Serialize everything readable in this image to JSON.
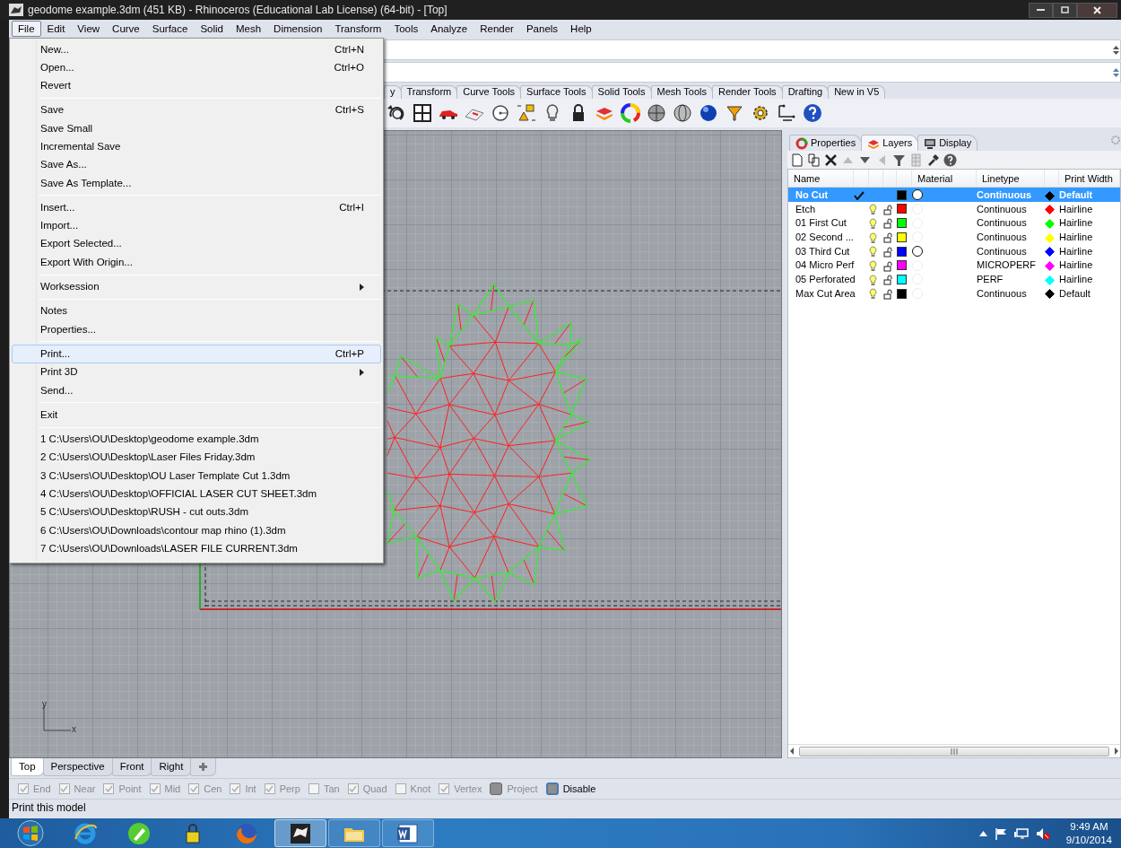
{
  "window": {
    "title": "geodome example.3dm (451 KB) - Rhinoceros (Educational Lab License) (64-bit) - [Top]"
  },
  "menu_bar": [
    {
      "label": "File",
      "selected": true
    },
    {
      "label": "Edit",
      "selected": false
    },
    {
      "label": "View",
      "selected": false
    },
    {
      "label": "Curve",
      "selected": false
    },
    {
      "label": "Surface",
      "selected": false
    },
    {
      "label": "Solid",
      "selected": false
    },
    {
      "label": "Mesh",
      "selected": false
    },
    {
      "label": "Dimension",
      "selected": false
    },
    {
      "label": "Transform",
      "selected": false
    },
    {
      "label": "Tools",
      "selected": false
    },
    {
      "label": "Analyze",
      "selected": false
    },
    {
      "label": "Render",
      "selected": false
    },
    {
      "label": "Panels",
      "selected": false
    },
    {
      "label": "Help",
      "selected": false
    }
  ],
  "file_menu": {
    "groups": [
      [
        {
          "label": "New...",
          "shortcut": "Ctrl+N",
          "submenu": false,
          "highlighted": false
        },
        {
          "label": "Open...",
          "shortcut": "Ctrl+O",
          "submenu": false,
          "highlighted": false
        },
        {
          "label": "Revert",
          "submenu": false,
          "highlighted": false
        }
      ],
      [
        {
          "label": "Save",
          "shortcut": "Ctrl+S",
          "submenu": false,
          "highlighted": false
        },
        {
          "label": "Save Small",
          "submenu": false,
          "highlighted": false
        },
        {
          "label": "Incremental Save",
          "submenu": false,
          "highlighted": false
        },
        {
          "label": "Save As...",
          "submenu": false,
          "highlighted": false
        },
        {
          "label": "Save As Template...",
          "submenu": false,
          "highlighted": false
        }
      ],
      [
        {
          "label": "Insert...",
          "shortcut": "Ctrl+I",
          "submenu": false,
          "highlighted": false
        },
        {
          "label": "Import...",
          "submenu": false,
          "highlighted": false
        },
        {
          "label": "Export Selected...",
          "submenu": false,
          "highlighted": false
        },
        {
          "label": "Export With Origin...",
          "submenu": false,
          "highlighted": false
        }
      ],
      [
        {
          "label": "Worksession",
          "submenu": true,
          "highlighted": false
        }
      ],
      [
        {
          "label": "Notes",
          "submenu": false,
          "highlighted": false
        },
        {
          "label": "Properties...",
          "submenu": false,
          "highlighted": false
        }
      ],
      [
        {
          "label": "Print...",
          "shortcut": "Ctrl+P",
          "submenu": false,
          "highlighted": true
        },
        {
          "label": "Print 3D",
          "submenu": true,
          "highlighted": false
        },
        {
          "label": "Send...",
          "submenu": false,
          "highlighted": false
        }
      ],
      [
        {
          "label": "Exit",
          "submenu": false,
          "highlighted": false
        }
      ],
      [
        {
          "label": "1 C:\\Users\\OU\\Desktop\\geodome example.3dm",
          "submenu": false,
          "highlighted": false
        },
        {
          "label": "2 C:\\Users\\OU\\Desktop\\Laser Files Friday.3dm",
          "submenu": false,
          "highlighted": false
        },
        {
          "label": "3 C:\\Users\\OU\\Desktop\\OU Laser Template Cut 1.3dm",
          "submenu": false,
          "highlighted": false
        },
        {
          "label": "4 C:\\Users\\OU\\Desktop\\OFFICIAL LASER CUT SHEET.3dm",
          "submenu": false,
          "highlighted": false
        },
        {
          "label": "5 C:\\Users\\OU\\Desktop\\RUSH - cut outs.3dm",
          "submenu": false,
          "highlighted": false
        },
        {
          "label": "6 C:\\Users\\OU\\Downloads\\contour map rhino  (1).3dm",
          "submenu": false,
          "highlighted": false
        },
        {
          "label": "7 C:\\Users\\OU\\Downloads\\LASER FILE CURRENT.3dm",
          "submenu": false,
          "highlighted": false
        }
      ]
    ]
  },
  "toolbar_tabs": [
    "y",
    "Transform",
    "Curve Tools",
    "Surface Tools",
    "Solid Tools",
    "Mesh Tools",
    "Render Tools",
    "Drafting",
    "New in V5"
  ],
  "panel": {
    "tabs": [
      {
        "label": "Properties",
        "selected": false
      },
      {
        "label": "Layers",
        "selected": true
      },
      {
        "label": "Display",
        "selected": false
      }
    ],
    "columns": [
      "Name",
      "Material",
      "Linetype",
      "Print Width"
    ],
    "rows": [
      {
        "name": "No Cut",
        "selected": true,
        "current": true,
        "color": "#000000",
        "material_set": true,
        "linetype": "Continuous",
        "print": {
          "color": "#000000",
          "width": "Default"
        }
      },
      {
        "name": "Etch",
        "selected": false,
        "current": false,
        "color": "#ff0000",
        "material_set": false,
        "linetype": "Continuous",
        "print": {
          "color": "#ff0000",
          "width": "Hairline"
        }
      },
      {
        "name": "01 First Cut",
        "selected": false,
        "current": false,
        "color": "#00ff00",
        "material_set": false,
        "linetype": "Continuous",
        "print": {
          "color": "#00ff00",
          "width": "Hairline"
        }
      },
      {
        "name": "02 Second ...",
        "selected": false,
        "current": false,
        "color": "#ffff00",
        "material_set": false,
        "linetype": "Continuous",
        "print": {
          "color": "#ffff00",
          "width": "Hairline"
        }
      },
      {
        "name": "03 Third Cut",
        "selected": false,
        "current": false,
        "color": "#0000ff",
        "material_set": true,
        "linetype": "Continuous",
        "print": {
          "color": "#0000ff",
          "width": "Hairline"
        }
      },
      {
        "name": "04 Micro Perf",
        "selected": false,
        "current": false,
        "color": "#ff00ff",
        "material_set": false,
        "linetype": "MICROPERF",
        "print": {
          "color": "#ff00ff",
          "width": "Hairline"
        }
      },
      {
        "name": "05 Perforated",
        "selected": false,
        "current": false,
        "color": "#00ffff",
        "material_set": false,
        "linetype": "PERF",
        "print": {
          "color": "#00ffff",
          "width": "Hairline"
        }
      },
      {
        "name": "Max Cut Area",
        "selected": false,
        "current": false,
        "color": "#000000",
        "material_set": false,
        "linetype": "Continuous",
        "print": {
          "color": "#000000",
          "width": "Default"
        }
      }
    ]
  },
  "viewport": {
    "axis_labels": [
      "y",
      "x"
    ],
    "tabs": [
      {
        "label": "Top",
        "selected": true
      },
      {
        "label": "Perspective",
        "selected": false
      },
      {
        "label": "Front",
        "selected": false
      },
      {
        "label": "Right",
        "selected": false
      }
    ]
  },
  "osnaps": [
    {
      "kind": "check",
      "label": "End",
      "checked": true,
      "disabled": true
    },
    {
      "kind": "check",
      "label": "Near",
      "checked": true,
      "disabled": true
    },
    {
      "kind": "check",
      "label": "Point",
      "checked": true,
      "disabled": true
    },
    {
      "kind": "check",
      "label": "Mid",
      "checked": true,
      "disabled": true
    },
    {
      "kind": "check",
      "label": "Cen",
      "checked": true,
      "disabled": true
    },
    {
      "kind": "check",
      "label": "Int",
      "checked": true,
      "disabled": true
    },
    {
      "kind": "check",
      "label": "Perp",
      "checked": true,
      "disabled": true
    },
    {
      "kind": "check",
      "label": "Tan",
      "checked": false,
      "disabled": true
    },
    {
      "kind": "check",
      "label": "Quad",
      "checked": true,
      "disabled": true
    },
    {
      "kind": "check",
      "label": "Knot",
      "checked": false,
      "disabled": true
    },
    {
      "kind": "check",
      "label": "Vertex",
      "checked": true,
      "disabled": true
    },
    {
      "kind": "toggle",
      "label": "Project",
      "checked": false,
      "disabled": true
    },
    {
      "kind": "toggle",
      "label": "Disable",
      "checked": true,
      "disabled": false
    }
  ],
  "status_bar": "Print this model",
  "taskbar": {
    "apps": [
      {
        "kind": "browser",
        "running": false,
        "active": false
      },
      {
        "kind": "pen",
        "running": false,
        "active": false
      },
      {
        "kind": "lock",
        "running": false,
        "active": false
      },
      {
        "kind": "fox",
        "running": false,
        "active": false
      },
      {
        "kind": "rhino",
        "running": true,
        "active": true
      },
      {
        "kind": "folder",
        "running": true,
        "active": false
      },
      {
        "kind": "word",
        "running": true,
        "active": false
      }
    ],
    "time": "9:49 AM",
    "date": "9/10/2014"
  }
}
